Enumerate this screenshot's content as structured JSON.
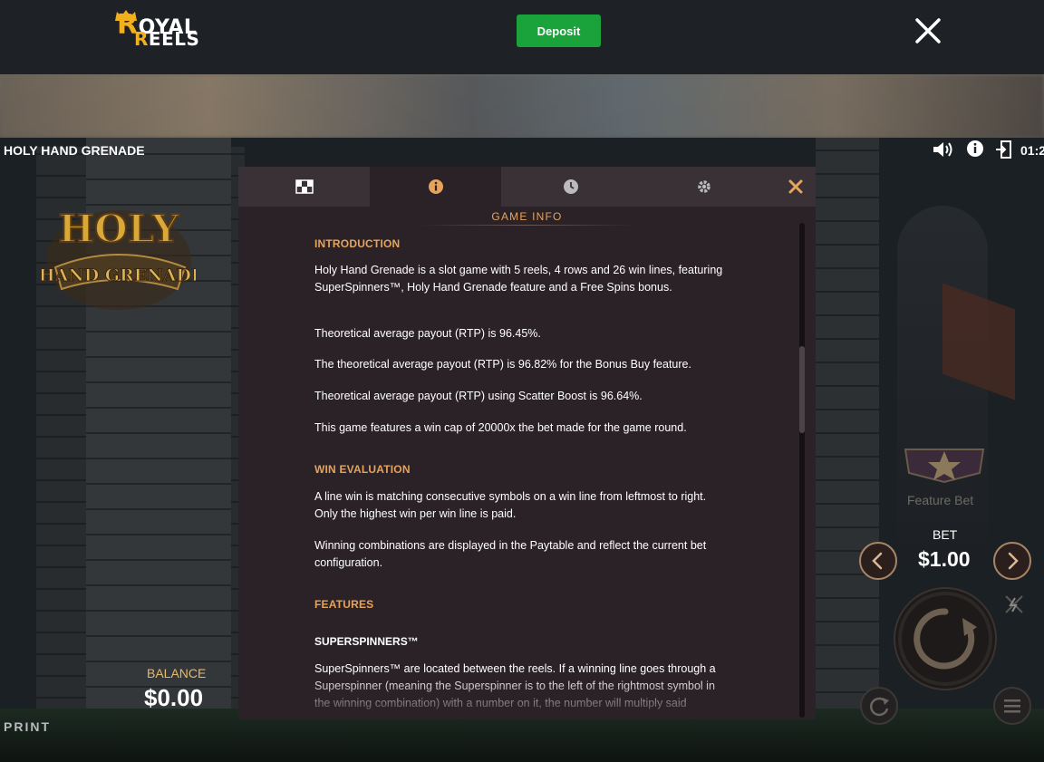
{
  "topbar": {
    "logo": {
      "line1": "OYAL",
      "line1_initial": "R",
      "line2": "EELS",
      "line2_initial": "R"
    },
    "deposit_label": "Deposit"
  },
  "game": {
    "title": "HOLY HAND GRENADE",
    "logo": {
      "line1": "HOLY",
      "line2": "HAND GRENADE"
    },
    "clock": "01:2",
    "balance_label": "BALANCE",
    "balance_value": "$0.00",
    "print_label": "PRINT",
    "feature_bet_label": "Feature Bet",
    "bet_label": "BET",
    "bet_value": "$1.00"
  },
  "modal": {
    "tabs": [
      {
        "icon": "paytable-icon"
      },
      {
        "icon": "info-icon"
      },
      {
        "icon": "history-icon"
      },
      {
        "icon": "settings-icon"
      }
    ],
    "heading": "GAME INFO",
    "sections": {
      "introduction": {
        "title": "INTRODUCTION",
        "p1": "Holy Hand Grenade is a slot game with 5 reels, 4 rows and 26 win lines, featuring SuperSpinners™, Holy Hand Grenade feature and a Free Spins bonus.",
        "p2": "Theoretical average payout (RTP) is 96.45%.",
        "p3": "The theoretical average payout (RTP) is 96.82% for the Bonus Buy feature.",
        "p4": "Theoretical average payout (RTP) using Scatter Boost is 96.64%.",
        "p5": "This game features a win cap of 20000x the bet made for the game round."
      },
      "win_evaluation": {
        "title": "WIN EVALUATION",
        "p1": "A line win is matching consecutive symbols on a win line from leftmost to right. Only the highest win per win line is paid.",
        "p2": "Winning combinations are displayed in the Paytable and reflect the current bet configuration."
      },
      "features": {
        "title": "FEATURES",
        "sub_title": "SUPERSPINNERS™",
        "p1": "SuperSpinners™ are located between the reels. If a winning line goes through a Superspinner (meaning the Superspinner is to the left of the rightmost symbol in the winning combination) with a number on it, the number will multiply said"
      }
    }
  },
  "colors": {
    "accent": "#e6a35c",
    "deposit": "#19a33a",
    "modal_bg": "#2a2227",
    "topbar_bg": "#1e2227"
  }
}
